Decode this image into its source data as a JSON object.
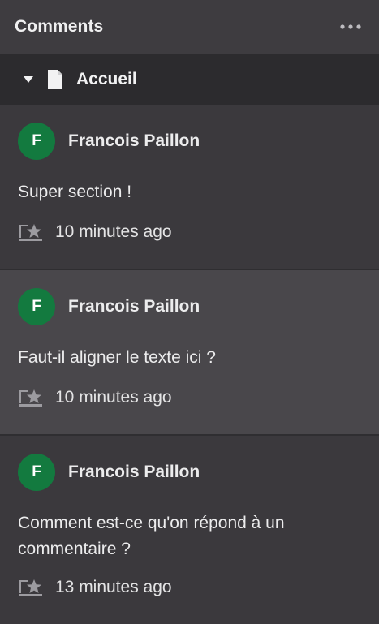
{
  "header": {
    "title": "Comments",
    "more_icon": "more-horizontal-icon"
  },
  "section": {
    "label": "Accueil",
    "caret_icon": "caret-down-icon",
    "doc_icon": "document-icon"
  },
  "comments": [
    {
      "avatar_initial": "F",
      "author": "Francois Paillon",
      "text": "Super section !",
      "time": "10 minutes ago"
    },
    {
      "avatar_initial": "F",
      "author": "Francois Paillon",
      "text": "Faut-il aligner le texte ici ?",
      "time": "10 minutes ago"
    },
    {
      "avatar_initial": "F",
      "author": "Francois Paillon",
      "text": "Comment est-ce qu'on répond à un commentaire ?",
      "time": "13 minutes ago"
    }
  ],
  "colors": {
    "avatar": "#137a3f",
    "panel_bg": "#3b393d",
    "section_bg": "#2c2b2e",
    "highlight_bg": "#49474b"
  }
}
